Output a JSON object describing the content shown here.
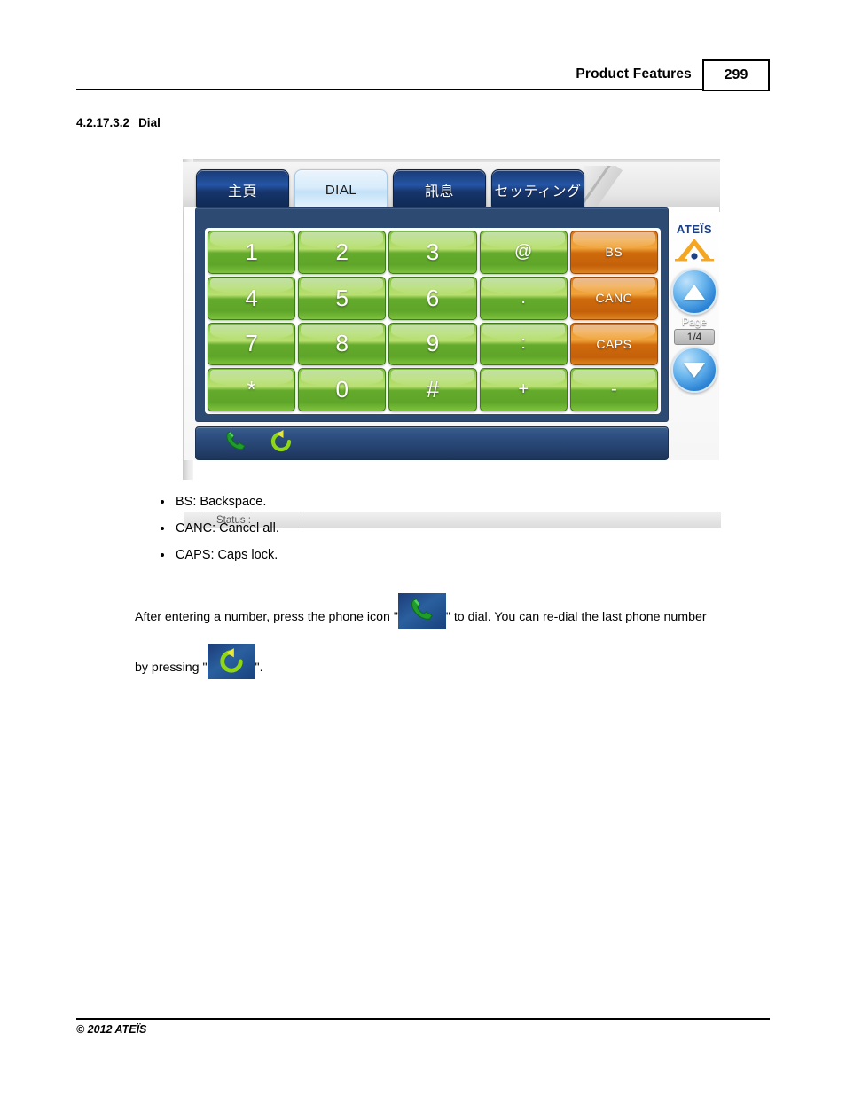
{
  "header": {
    "title": "Product Features",
    "page_number": "299"
  },
  "section": {
    "number": "4.2.17.3.2",
    "title": "Dial"
  },
  "device": {
    "tabs": [
      {
        "label": "主頁",
        "active": false
      },
      {
        "label": "DIAL",
        "active": true
      },
      {
        "label": "訊息",
        "active": false
      },
      {
        "label": "セッティング",
        "active": false
      }
    ],
    "brand": "ATEÏS",
    "keypad": {
      "rows": [
        [
          {
            "label": "1",
            "color": "green"
          },
          {
            "label": "2",
            "color": "green"
          },
          {
            "label": "3",
            "color": "green"
          },
          {
            "label": "@",
            "color": "green"
          },
          {
            "label": "BS",
            "color": "orange"
          }
        ],
        [
          {
            "label": "4",
            "color": "green"
          },
          {
            "label": "5",
            "color": "green"
          },
          {
            "label": "6",
            "color": "green"
          },
          {
            "label": ".",
            "color": "green"
          },
          {
            "label": "CANC",
            "color": "orange"
          }
        ],
        [
          {
            "label": "7",
            "color": "green"
          },
          {
            "label": "8",
            "color": "green"
          },
          {
            "label": "9",
            "color": "green"
          },
          {
            "label": ":",
            "color": "green"
          },
          {
            "label": "CAPS",
            "color": "orange"
          }
        ],
        [
          {
            "label": "*",
            "color": "green"
          },
          {
            "label": "0",
            "color": "green"
          },
          {
            "label": "#",
            "color": "green"
          },
          {
            "label": "+",
            "color": "green"
          },
          {
            "label": "-",
            "color": "green"
          }
        ]
      ]
    },
    "page_nav": {
      "up_icon": "triangle-up-icon",
      "down_icon": "triangle-down-icon",
      "label": "Page",
      "value": "1/4"
    },
    "action_bar": {
      "dial_icon": "phone-handset-icon",
      "redial_icon": "redial-arrow-icon"
    },
    "status_bar": {
      "label": "Status :"
    }
  },
  "bullets": [
    "BS: Backspace.",
    "CANC: Cancel all.",
    "CAPS: Caps lock."
  ],
  "paragraph": {
    "part1": "After entering a number, press the phone icon \"",
    "part2": "\" to dial. You can re-dial the last phone number",
    "part3": "by pressing \"",
    "part4": "\"."
  },
  "footer": {
    "copyright": "© 2012 ATEÏS"
  },
  "colors": {
    "key_green": "#7cba3d",
    "key_orange": "#d06a10",
    "panel_navy": "#2d4a72",
    "tab_blue": "#1a3a75",
    "brand_blue": "#1d3f86",
    "brand_orange": "#f5a623",
    "nav_button_blue": "#2f86d6"
  }
}
